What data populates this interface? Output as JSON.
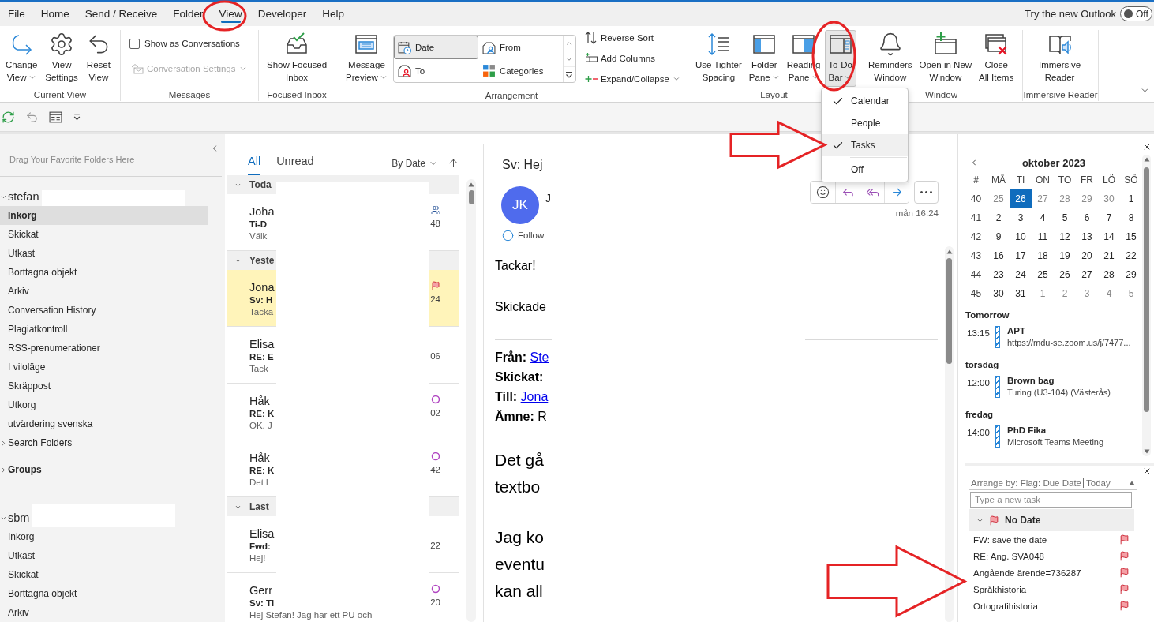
{
  "menu_tabs": [
    {
      "label": "File",
      "selected": false
    },
    {
      "label": "Home",
      "selected": false
    },
    {
      "label": "Send / Receive",
      "selected": false
    },
    {
      "label": "Folder",
      "selected": false
    },
    {
      "label": "View",
      "selected": true
    },
    {
      "label": "Developer",
      "selected": false
    },
    {
      "label": "Help",
      "selected": false
    }
  ],
  "new_outlook": {
    "label": "Try the new Outlook",
    "toggle_text": "Off",
    "on": false
  },
  "ribbon": {
    "groups": [
      {
        "label": "Current View",
        "controls": [
          {
            "kind": "large",
            "lines": [
              "Change",
              "View"
            ],
            "dropdown": true,
            "pressed": false
          },
          {
            "kind": "large",
            "lines": [
              "View",
              "Settings"
            ],
            "dropdown": false,
            "pressed": false
          },
          {
            "kind": "large",
            "lines": [
              "Reset",
              "View"
            ],
            "dropdown": false,
            "pressed": false
          }
        ]
      },
      {
        "label": "Messages",
        "controls": [
          {
            "kind": "checkbox",
            "label": "Show as Conversations",
            "checked": false
          },
          {
            "kind": "small",
            "label": "Conversation Settings",
            "dropdown": true,
            "disabled": true
          }
        ]
      },
      {
        "label": "Focused Inbox",
        "controls": [
          {
            "kind": "large",
            "lines": [
              "Show Focused",
              "Inbox"
            ],
            "dropdown": false,
            "pressed": false
          }
        ]
      },
      {
        "label": "Arrangement",
        "controls": [
          {
            "kind": "large",
            "lines": [
              "Message",
              "Preview"
            ],
            "dropdown": true,
            "pressed": false
          },
          {
            "kind": "gallery",
            "options": [
              {
                "label": "Date",
                "selected": true
              },
              {
                "label": "From",
                "selected": false
              },
              {
                "label": "To",
                "selected": false
              },
              {
                "label": "Categories",
                "selected": false
              }
            ]
          },
          {
            "kind": "stack",
            "items": [
              {
                "label": "Reverse Sort",
                "dropdown": false,
                "disabled": false
              },
              {
                "label": "Add Columns",
                "dropdown": false,
                "disabled": false
              },
              {
                "label": "Expand/Collapse",
                "dropdown": true,
                "disabled": false
              }
            ]
          }
        ]
      },
      {
        "label": "Layout",
        "controls": [
          {
            "kind": "large",
            "lines": [
              "Use Tighter",
              "Spacing"
            ],
            "dropdown": false,
            "pressed": false
          },
          {
            "kind": "large",
            "lines": [
              "Folder",
              "Pane"
            ],
            "dropdown": true,
            "pressed": false
          },
          {
            "kind": "large",
            "lines": [
              "Reading",
              "Pane"
            ],
            "dropdown": true,
            "pressed": false
          },
          {
            "kind": "large",
            "lines": [
              "To-Do",
              "Bar"
            ],
            "dropdown": true,
            "pressed": true
          }
        ]
      },
      {
        "label": "Window",
        "controls": [
          {
            "kind": "large",
            "lines": [
              "Reminders",
              "Window"
            ],
            "dropdown": false,
            "pressed": false
          },
          {
            "kind": "large",
            "lines": [
              "Open in New",
              "Window"
            ],
            "dropdown": false,
            "pressed": false
          },
          {
            "kind": "large",
            "lines": [
              "Close",
              "All Items"
            ],
            "dropdown": false,
            "pressed": false
          }
        ]
      },
      {
        "label": "Immersive Reader",
        "controls": [
          {
            "kind": "large",
            "lines": [
              "Immersive",
              "Reader"
            ],
            "dropdown": false,
            "pressed": false
          }
        ]
      }
    ]
  },
  "todo_menu": {
    "items": [
      {
        "kind": "option",
        "label": "Calendar",
        "checked": true,
        "highlighted": false
      },
      {
        "kind": "option",
        "label": "People",
        "checked": false,
        "highlighted": false
      },
      {
        "kind": "option",
        "label": "Tasks",
        "checked": true,
        "highlighted": true
      },
      {
        "kind": "separator"
      },
      {
        "kind": "option",
        "label": "Off",
        "checked": false,
        "highlighted": false
      }
    ]
  },
  "folder_pane": {
    "favorites_hint": "Drag Your Favorite Folders Here",
    "tree": [
      {
        "kind": "account",
        "label": "stefan",
        "expanded": true,
        "selected": false,
        "redacted": true,
        "children": [
          {
            "label": "Inkorg",
            "selected": true
          },
          {
            "label": "Skickat",
            "selected": false
          },
          {
            "label": "Utkast",
            "selected": false
          },
          {
            "label": "Borttagna objekt",
            "selected": false
          },
          {
            "label": "Arkiv",
            "selected": false
          },
          {
            "label": "Conversation History",
            "selected": false
          },
          {
            "label": "Plagiatkontroll",
            "selected": false
          },
          {
            "label": "RSS-prenumerationer",
            "selected": false
          },
          {
            "label": "I viloläge",
            "selected": false
          },
          {
            "label": "Skräppost",
            "selected": false
          },
          {
            "label": "Utkorg",
            "selected": false
          },
          {
            "label": "utvärdering svenska",
            "selected": false
          },
          {
            "label": "Search Folders",
            "selected": false,
            "expanded": false
          }
        ]
      },
      {
        "kind": "section",
        "label": "Groups",
        "expanded": false,
        "selected": false,
        "redacted": false
      },
      {
        "kind": "account",
        "label": "sbm",
        "expanded": true,
        "selected": false,
        "redacted": true,
        "children": [
          {
            "label": "Inkorg",
            "selected": false
          },
          {
            "label": "Utkast",
            "selected": false
          },
          {
            "label": "Skickat",
            "selected": false
          },
          {
            "label": "Borttagna objekt",
            "selected": false
          },
          {
            "label": "Arkiv",
            "selected": false
          }
        ]
      }
    ]
  },
  "message_list": {
    "redacted": true,
    "tabs": [
      {
        "label": "All",
        "selected": true
      },
      {
        "label": "Unread",
        "selected": false
      }
    ],
    "sort_label": "By Date",
    "groups": [
      {
        "label": "Toda",
        "expanded": true,
        "messages": [
          {
            "sender": "Joha",
            "subject": "Ti-D",
            "preview": "Välk",
            "time": "48",
            "selected": false,
            "meeting": true,
            "flagged": false,
            "marked": false
          }
        ]
      },
      {
        "label": "Yeste",
        "expanded": true,
        "messages": [
          {
            "sender": "Jona",
            "subject": "Sv: H",
            "preview": "Tacka",
            "time": "24",
            "selected": true,
            "meeting": false,
            "flagged": true,
            "marked": false
          },
          {
            "sender": "Elisa",
            "subject": "RE: E",
            "preview": "Tack",
            "time": "06",
            "selected": false,
            "meeting": false,
            "flagged": false,
            "marked": false
          },
          {
            "sender": "Håk",
            "subject": "RE: K",
            "preview": "OK. J",
            "time": "02",
            "selected": false,
            "meeting": false,
            "flagged": false,
            "marked": true
          },
          {
            "sender": "Håk",
            "subject": "RE: K",
            "preview": "Det l",
            "time": "42",
            "selected": false,
            "meeting": false,
            "flagged": false,
            "marked": true
          }
        ]
      },
      {
        "label": "Last",
        "expanded": true,
        "messages": [
          {
            "sender": "Elisa",
            "subject": "Fwd:",
            "preview": "Hej!",
            "time": "22",
            "selected": false,
            "meeting": false,
            "flagged": false,
            "marked": false
          },
          {
            "sender": "Gerr",
            "subject": "Sv: Ti",
            "preview": "Hej Stefan! Jag har ett PU och",
            "time": "20",
            "selected": false,
            "meeting": false,
            "flagged": false,
            "marked": true
          }
        ]
      }
    ]
  },
  "reading_pane": {
    "redacted": true,
    "subject": "Sv: Hej",
    "avatar_initials": "JK",
    "sender": "J",
    "follow_up": "Follow",
    "time": "mån 16:24",
    "body_lines": [
      "Tackar!",
      "Skickade"
    ],
    "header_fields": [
      {
        "label": "Från:",
        "value": "Ste",
        "link": true
      },
      {
        "label": "Skickat:",
        "link": false
      },
      {
        "label": "Till:",
        "value": "Jona",
        "link": true
      },
      {
        "label": "Ämne:",
        "value": "R",
        "link": false
      }
    ],
    "paragraphs": [
      [
        "Det gå",
        "textbo"
      ],
      [
        "Jag ko",
        "eventu",
        "kan all"
      ]
    ]
  },
  "todo_bar": {
    "calendar": {
      "title": "oktober 2023",
      "week_label": "#",
      "weekdays": [
        "MÅ",
        "TI",
        "ON",
        "TO",
        "FR",
        "LÖ",
        "SÖ"
      ],
      "weeks": [
        {
          "number": "40",
          "days": [
            {
              "label": "25",
              "in_month": false,
              "selected": false
            },
            {
              "label": "26",
              "in_month": false,
              "selected": true
            },
            {
              "label": "27",
              "in_month": false,
              "selected": false
            },
            {
              "label": "28",
              "in_month": false,
              "selected": false
            },
            {
              "label": "29",
              "in_month": false,
              "selected": false
            },
            {
              "label": "30",
              "in_month": false,
              "selected": false
            },
            {
              "label": "1",
              "in_month": true,
              "selected": false
            }
          ]
        },
        {
          "number": "41",
          "days": [
            {
              "label": "2",
              "in_month": true,
              "selected": false
            },
            {
              "label": "3",
              "in_month": true,
              "selected": false
            },
            {
              "label": "4",
              "in_month": true,
              "selected": false
            },
            {
              "label": "5",
              "in_month": true,
              "selected": false
            },
            {
              "label": "6",
              "in_month": true,
              "selected": false
            },
            {
              "label": "7",
              "in_month": true,
              "selected": false
            },
            {
              "label": "8",
              "in_month": true,
              "selected": false
            }
          ]
        },
        {
          "number": "42",
          "days": [
            {
              "label": "9",
              "in_month": true,
              "selected": false
            },
            {
              "label": "10",
              "in_month": true,
              "selected": false
            },
            {
              "label": "11",
              "in_month": true,
              "selected": false
            },
            {
              "label": "12",
              "in_month": true,
              "selected": false
            },
            {
              "label": "13",
              "in_month": true,
              "selected": false
            },
            {
              "label": "14",
              "in_month": true,
              "selected": false
            },
            {
              "label": "15",
              "in_month": true,
              "selected": false
            }
          ]
        },
        {
          "number": "43",
          "days": [
            {
              "label": "16",
              "in_month": true,
              "selected": false
            },
            {
              "label": "17",
              "in_month": true,
              "selected": false
            },
            {
              "label": "18",
              "in_month": true,
              "selected": false
            },
            {
              "label": "19",
              "in_month": true,
              "selected": false
            },
            {
              "label": "20",
              "in_month": true,
              "selected": false
            },
            {
              "label": "21",
              "in_month": true,
              "selected": false
            },
            {
              "label": "22",
              "in_month": true,
              "selected": false
            }
          ]
        },
        {
          "number": "44",
          "days": [
            {
              "label": "23",
              "in_month": true,
              "selected": false
            },
            {
              "label": "24",
              "in_month": true,
              "selected": false
            },
            {
              "label": "25",
              "in_month": true,
              "selected": false
            },
            {
              "label": "26",
              "in_month": true,
              "selected": false
            },
            {
              "label": "27",
              "in_month": true,
              "selected": false
            },
            {
              "label": "28",
              "in_month": true,
              "selected": false
            },
            {
              "label": "29",
              "in_month": true,
              "selected": false
            }
          ]
        },
        {
          "number": "45",
          "days": [
            {
              "label": "30",
              "in_month": true,
              "selected": false
            },
            {
              "label": "31",
              "in_month": true,
              "selected": false
            },
            {
              "label": "1",
              "in_month": false,
              "selected": false
            },
            {
              "label": "2",
              "in_month": false,
              "selected": false
            },
            {
              "label": "3",
              "in_month": false,
              "selected": false
            },
            {
              "label": "4",
              "in_month": false,
              "selected": false
            },
            {
              "label": "5",
              "in_month": false,
              "selected": false
            }
          ]
        }
      ]
    },
    "agenda": [
      {
        "day": "Tomorrow",
        "events": [
          {
            "time": "13:15",
            "title": "APT",
            "detail": "https://mdu-se.zoom.us/j/7477..."
          }
        ]
      },
      {
        "day": "torsdag",
        "events": [
          {
            "time": "12:00",
            "title": "Brown bag",
            "detail": "Turing (U3-104) (Västerås)"
          }
        ]
      },
      {
        "day": "fredag",
        "events": [
          {
            "time": "14:00",
            "title": "PhD Fika",
            "detail": "Microsoft Teams Meeting"
          }
        ]
      }
    ],
    "tasks": {
      "arrange_label": "Arrange by: Flag: Due Date",
      "arrange_value": "Today",
      "placeholder": "Type a new task",
      "groups": [
        {
          "label": "No Date",
          "expanded": true,
          "items": [
            {
              "title": "FW: save the date",
              "flagged": true
            },
            {
              "title": "RE: Ang. SVA048",
              "flagged": true
            },
            {
              "title": "Angående ärende=736287",
              "flagged": true
            },
            {
              "title": "Språkhistoria",
              "flagged": true
            },
            {
              "title": "Ortografihistoria",
              "flagged": true
            }
          ]
        }
      ]
    }
  },
  "annotations": [
    {
      "kind": "ellipse"
    },
    {
      "kind": "ellipse"
    },
    {
      "kind": "arrow"
    },
    {
      "kind": "arrow"
    }
  ]
}
